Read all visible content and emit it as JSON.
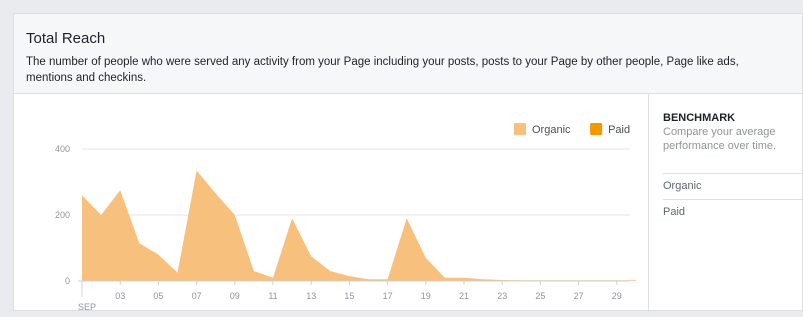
{
  "card": {
    "title": "Total Reach",
    "description": "The number of people who were served any activity from your Page including your posts, posts to your Page by other people, Page like ads, mentions and checkins."
  },
  "benchmark": {
    "title": "BENCHMARK",
    "description": "Compare your average performance over time.",
    "options": [
      "Organic",
      "Paid"
    ]
  },
  "chart_data": {
    "type": "area",
    "x_tick_labels": [
      "03",
      "05",
      "07",
      "09",
      "11",
      "13",
      "15",
      "17",
      "19",
      "21",
      "23",
      "25",
      "27",
      "29"
    ],
    "month_label": "SEP",
    "y_ticks": [
      0,
      200,
      400
    ],
    "ylim": [
      0,
      400
    ],
    "x_days": [
      1,
      2,
      3,
      4,
      5,
      6,
      7,
      8,
      9,
      10,
      11,
      12,
      13,
      14,
      15,
      16,
      17,
      18,
      19,
      20,
      21,
      22,
      23,
      24,
      25,
      26,
      27,
      28,
      29,
      30
    ],
    "series": [
      {
        "name": "Organic",
        "color": "#f8c07d",
        "values": [
          260,
          200,
          275,
          115,
          80,
          25,
          335,
          265,
          200,
          30,
          10,
          190,
          75,
          30,
          15,
          5,
          5,
          190,
          70,
          10,
          10,
          5,
          3,
          2,
          2,
          2,
          2,
          2,
          2,
          2
        ]
      },
      {
        "name": "Paid",
        "color": "#f29900",
        "values": [
          0,
          0,
          0,
          0,
          0,
          0,
          0,
          0,
          0,
          0,
          0,
          0,
          0,
          0,
          0,
          0,
          0,
          0,
          0,
          0,
          0,
          0,
          0,
          0,
          0,
          0,
          0,
          0,
          0,
          0
        ]
      }
    ],
    "legend_position": "top-right",
    "grid": true
  }
}
